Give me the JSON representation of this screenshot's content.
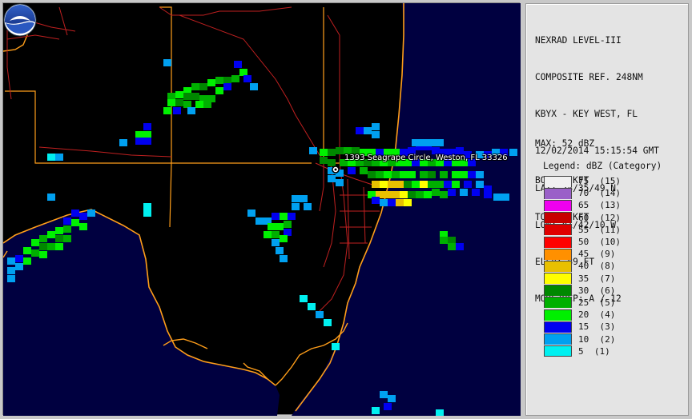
{
  "header": {
    "product": "NEXRAD LEVEL-III",
    "range": "COMPOSITE REF. 248NM",
    "station": "KBYX - KEY WEST, FL",
    "datetime": "12/02/2014 15:15:54 GMT",
    "lat": "LAT: 24/35/49 N",
    "lon": "LON: 81/42/10 W",
    "elev": "ELEV: 89 FT",
    "mode": "MODE/VCP: A / 12"
  },
  "stats": {
    "max": "MAX: 52 dBZ",
    "bot": "BOT: 0 KFT",
    "top": "TOP: 0 KFT"
  },
  "legend": {
    "title": "Legend: dBZ (Category)",
    "items": [
      {
        "label": "75  (15)",
        "color": "#f0f0f0"
      },
      {
        "label": "70  (14)",
        "color": "#9a60c8"
      },
      {
        "label": "65  (13)",
        "color": "#f000f0"
      },
      {
        "label": "60  (12)",
        "color": "#c80000"
      },
      {
        "label": "55  (11)",
        "color": "#e00000"
      },
      {
        "label": "50  (10)",
        "color": "#ff0000"
      },
      {
        "label": "45  (9)",
        "color": "#ff9000"
      },
      {
        "label": "40  (8)",
        "color": "#e8c000"
      },
      {
        "label": "35  (7)",
        "color": "#ffff00"
      },
      {
        "label": "30  (6)",
        "color": "#008800"
      },
      {
        "label": "25  (5)",
        "color": "#00b000"
      },
      {
        "label": "20  (4)",
        "color": "#00f000"
      },
      {
        "label": "15  (3)",
        "color": "#0000f0"
      },
      {
        "label": "10  (2)",
        "color": "#00a0f0"
      },
      {
        "label": "5  (1)",
        "color": "#00f0f0"
      }
    ]
  },
  "map": {
    "marker_label": "1393 Seagrape Circle, Weston, FL 33326",
    "colors": {
      "land": "#000000",
      "water": "#000040",
      "coast": "#ff9e1a",
      "roads": "#c02020"
    },
    "logo_text": "NOAA"
  }
}
